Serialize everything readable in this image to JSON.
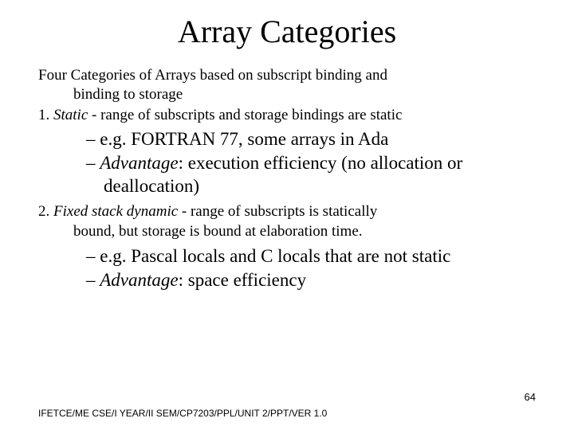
{
  "title": "Array Categories",
  "intro_line1": "Four Categories of Arrays based on subscript  binding and",
  "intro_line2": "binding to storage",
  "item1_num": "1. ",
  "item1_term": "Static",
  "item1_rest": " - range of subscripts and storage bindings are static",
  "item1_bullets": {
    "b1": "–  e.g. FORTRAN 77, some arrays in Ada",
    "b2_dash": "– ",
    "b2_label": "Advantage",
    "b2_rest": ": execution efficiency (no allocation or deallocation)"
  },
  "item2_num": "2. ",
  "item2_term": "Fixed stack dynamic",
  "item2_rest_a": " - range of subscripts is statically",
  "item2_rest_b": "bound, but storage is bound at elaboration time.",
  "item2_bullets": {
    "b1": "–  e.g. Pascal locals and C locals that are not static",
    "b2_dash": "– ",
    "b2_label": "Advantage",
    "b2_rest": ": space efficiency"
  },
  "footer": "IFETCE/ME CSE/I YEAR/II SEM/CP7203/PPL/UNIT 2/PPT/VER 1.0",
  "page_num": "64"
}
